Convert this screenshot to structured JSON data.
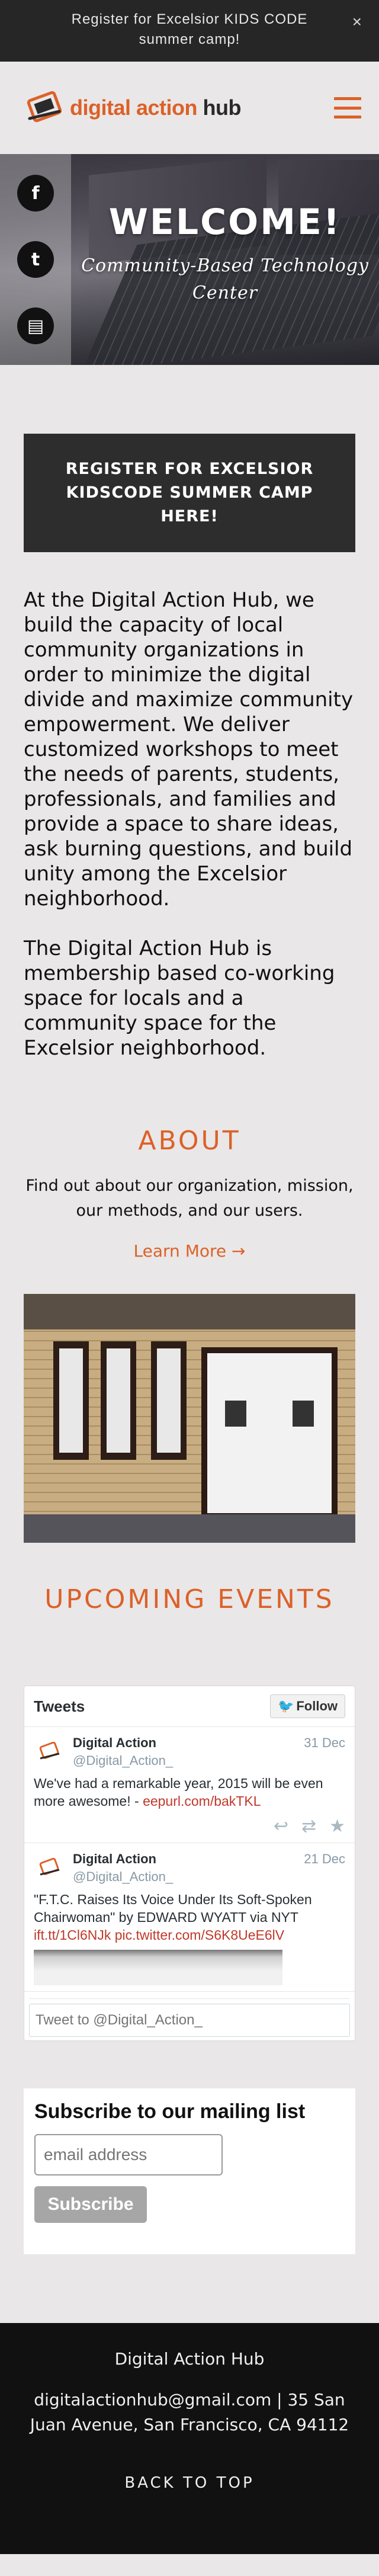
{
  "announcement": {
    "text": "Register for Excelsior KIDS CODE summer camp!",
    "close": "×"
  },
  "header": {
    "logo_word1": "digital action",
    "logo_word2": "hub",
    "menu_icon": "hamburger-menu-icon"
  },
  "hero": {
    "title": "WELCOME!",
    "tagline": "Community-Based Technology Center",
    "social": [
      {
        "icon": "facebook-icon",
        "glyph": "f"
      },
      {
        "icon": "twitter-icon",
        "glyph": "t"
      },
      {
        "icon": "newsletter-icon",
        "glyph": "▤"
      }
    ]
  },
  "cta": {
    "label": "REGISTER FOR EXCELSIOR KIDSCODE SUMMER CAMP HERE!"
  },
  "intro": {
    "paragraph1": "At the Digital Action Hub, we build the capacity of local community organizations in order to minimize the digital divide and maximize community empowerment. We deliver customized workshops to meet the needs of parents, students, professionals, and families and provide a space to share ideas, ask burning questions, and build unity among the Excelsior neighborhood.",
    "paragraph2": "The Digital Action Hub is membership based co-working space for locals and a community space for the Excelsior neighborhood."
  },
  "about": {
    "title": "ABOUT",
    "description": "Find out about our organization, mission, our methods, and our users.",
    "link": "Learn More →"
  },
  "events": {
    "title": "UPCOMING EVENTS"
  },
  "twitter": {
    "title": "Tweets",
    "follow": "Follow",
    "tweets": [
      {
        "name": "Digital Action",
        "handle": "@Digital_Action_",
        "date": "31 Dec",
        "text": "We've had a remarkable year, 2015 will be even more awesome! - ",
        "link": "eepurl.com/bakTKL"
      },
      {
        "name": "Digital Action",
        "handle": "@Digital_Action_",
        "date": "21 Dec",
        "text": "\"F.T.C. Raises Its Voice Under Its Soft-Spoken Chairwoman\" by EDWARD WYATT via NYT ",
        "link": "ift.tt/1Cl6NJk pic.twitter.com/S6K8UeE6lV"
      }
    ],
    "compose_placeholder": "Tweet to @Digital_Action_"
  },
  "subscribe": {
    "title": "Subscribe to our mailing list",
    "placeholder": "email address",
    "button": "Subscribe"
  },
  "footer": {
    "name": "Digital Action Hub",
    "contact": "digitalactionhub@gmail.com | 35 San Juan Avenue, San Francisco, CA 94112",
    "back_to_top": "BACK TO TOP"
  },
  "colors": {
    "accent": "#dc6128",
    "dark": "#2d2d2d",
    "background": "#e9e7e8"
  }
}
